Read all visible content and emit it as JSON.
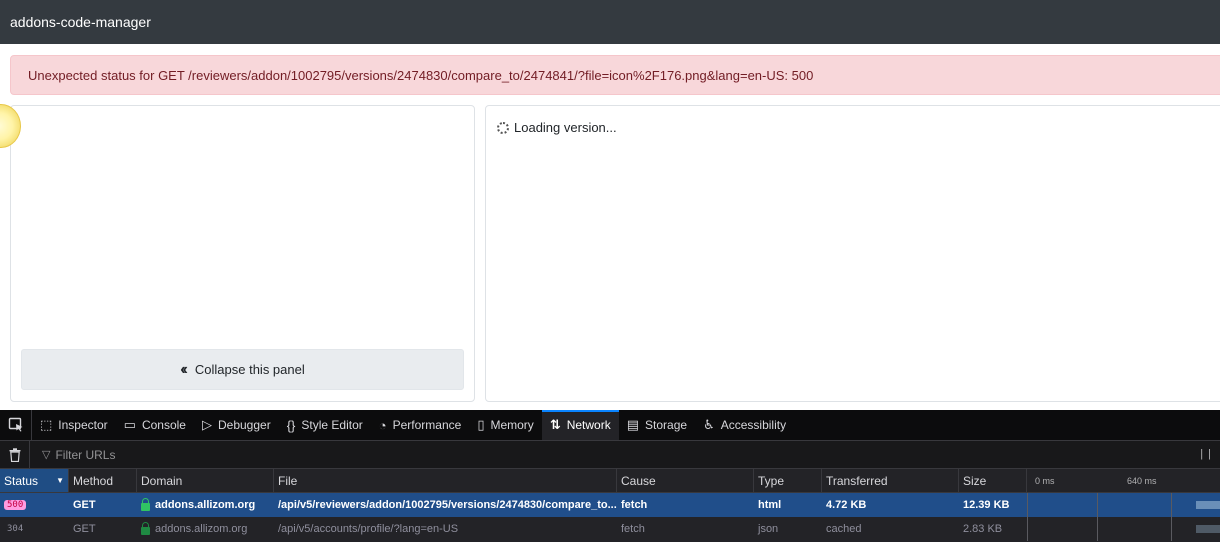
{
  "app": {
    "title": "addons-code-manager"
  },
  "alert": {
    "message": "Unexpected status for GET /reviewers/addon/1002795/versions/2474830/compare_to/2474841/?file=icon%2F176.png&lang=en-US: 500"
  },
  "left_panel": {
    "collapse_label": "Collapse this panel",
    "collapse_icon": "double-chevron-left-icon"
  },
  "right_panel": {
    "loading_text": "Loading version..."
  },
  "devtools": {
    "tabs": [
      {
        "label": "Inspector",
        "icon": "inspector-icon"
      },
      {
        "label": "Console",
        "icon": "console-icon"
      },
      {
        "label": "Debugger",
        "icon": "debugger-icon"
      },
      {
        "label": "Style Editor",
        "icon": "style-editor-icon"
      },
      {
        "label": "Performance",
        "icon": "performance-icon"
      },
      {
        "label": "Memory",
        "icon": "memory-icon"
      },
      {
        "label": "Network",
        "icon": "network-icon",
        "active": true
      },
      {
        "label": "Storage",
        "icon": "storage-icon"
      },
      {
        "label": "Accessibility",
        "icon": "accessibility-icon"
      }
    ],
    "filter_placeholder": "Filter URLs",
    "columns": {
      "status": "Status",
      "method": "Method",
      "domain": "Domain",
      "file": "File",
      "cause": "Cause",
      "type": "Type",
      "transferred": "Transferred",
      "size": "Size",
      "wf_tick_0": "0 ms",
      "wf_tick_1": "640 ms"
    },
    "requests": [
      {
        "status": "500",
        "method": "GET",
        "domain": "addons.allizom.org",
        "file": "/api/v5/reviewers/addon/1002795/versions/2474830/compare_to...",
        "cause": "fetch",
        "type": "html",
        "transferred": "4.72 KB",
        "size": "12.39 KB",
        "selected": true
      },
      {
        "status": "304",
        "method": "GET",
        "domain": "addons.allizom.org",
        "file": "/api/v5/accounts/profile/?lang=en-US",
        "cause": "fetch",
        "type": "json",
        "transferred": "cached",
        "size": "2.83 KB",
        "selected": false
      }
    ],
    "colors": {
      "accent": "#0a84ff",
      "selected_row": "#204e8a",
      "badge_500_bg": "#ff9ce0",
      "badge_500_fg": "#c50042"
    }
  }
}
